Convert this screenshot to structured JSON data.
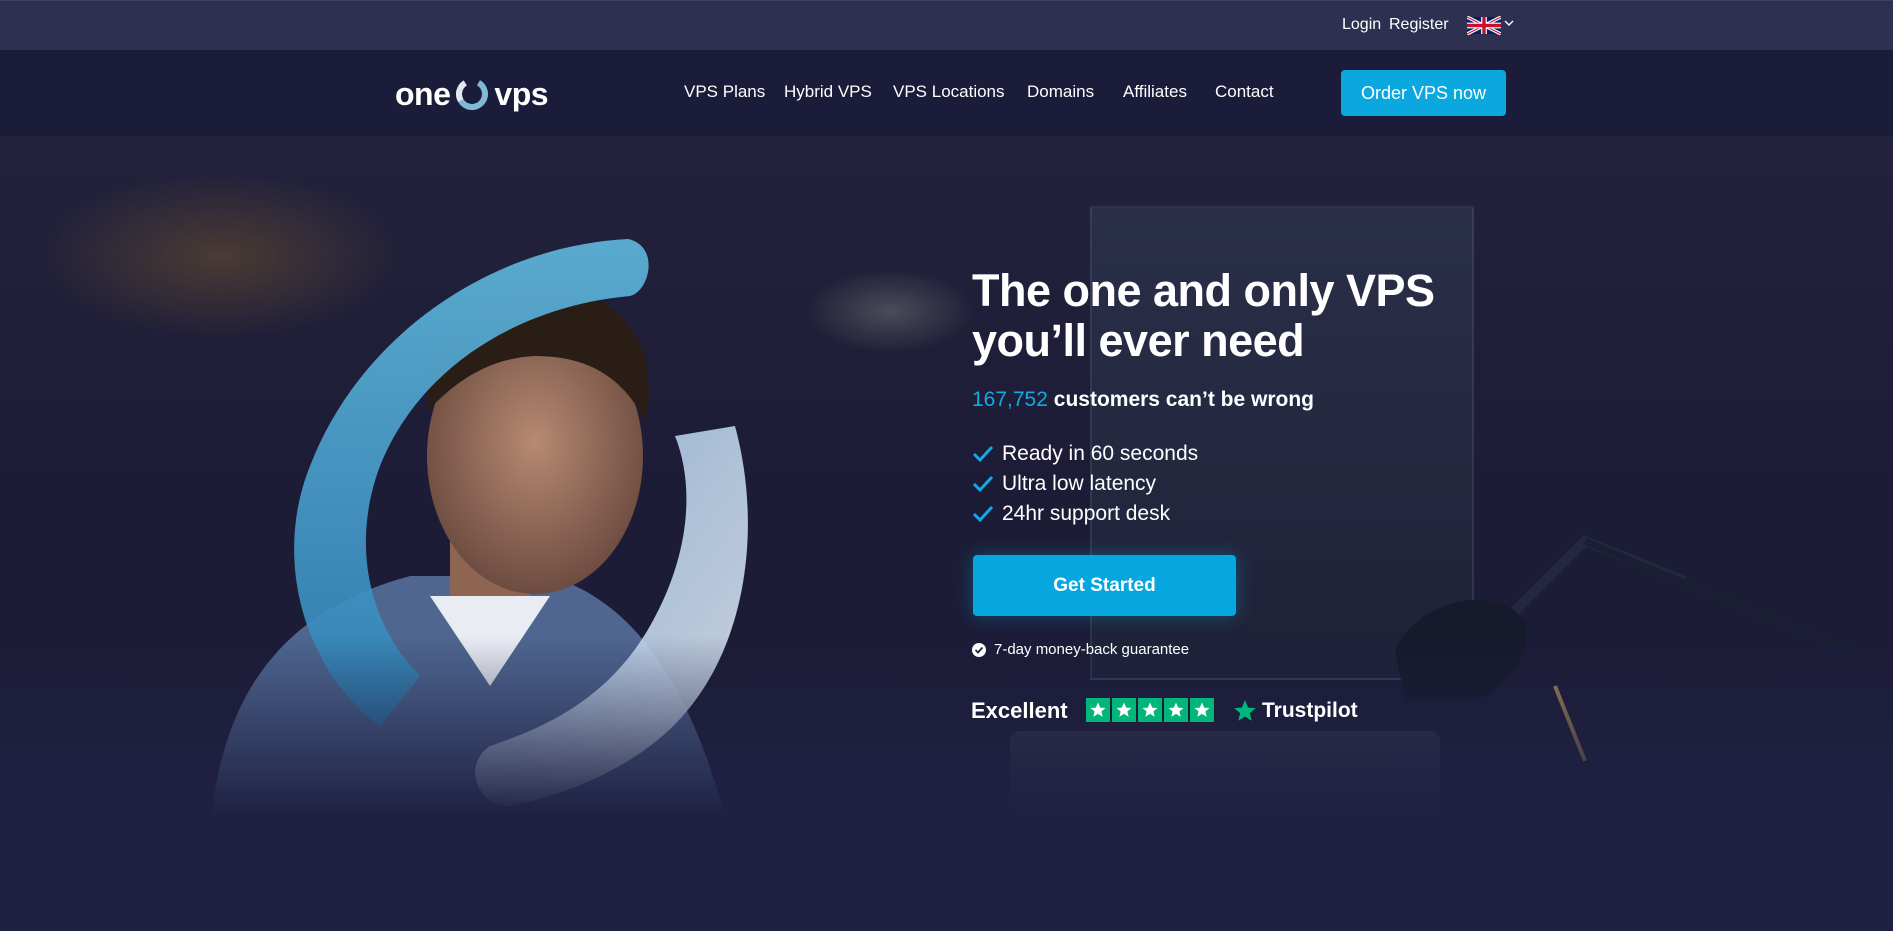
{
  "topbar": {
    "login": "Login",
    "register": "Register",
    "language_icon": "uk-flag-icon"
  },
  "brand": {
    "left": "one",
    "right": "vps"
  },
  "nav": {
    "items": [
      "VPS Plans",
      "Hybrid VPS",
      "VPS Locations",
      "Domains",
      "Affiliates",
      "Contact"
    ],
    "order_button": "Order VPS now"
  },
  "hero": {
    "headline_line1": "The one and only VPS",
    "headline_line2": "you’ll ever need",
    "customer_count": "167,752",
    "customer_text": "customers can’t be wrong",
    "features": [
      "Ready in 60 seconds",
      "Ultra low latency",
      "24hr support desk"
    ],
    "cta": "Get Started",
    "guarantee": "7-day money-back guarantee",
    "rating_label": "Excellent",
    "rating_stars": 5,
    "rating_brand": "Trustpilot"
  },
  "colors": {
    "accent": "#0aa8de",
    "trustpilot_green": "#00b67a",
    "background": "#1f2142",
    "topbar": "#2d3051"
  }
}
